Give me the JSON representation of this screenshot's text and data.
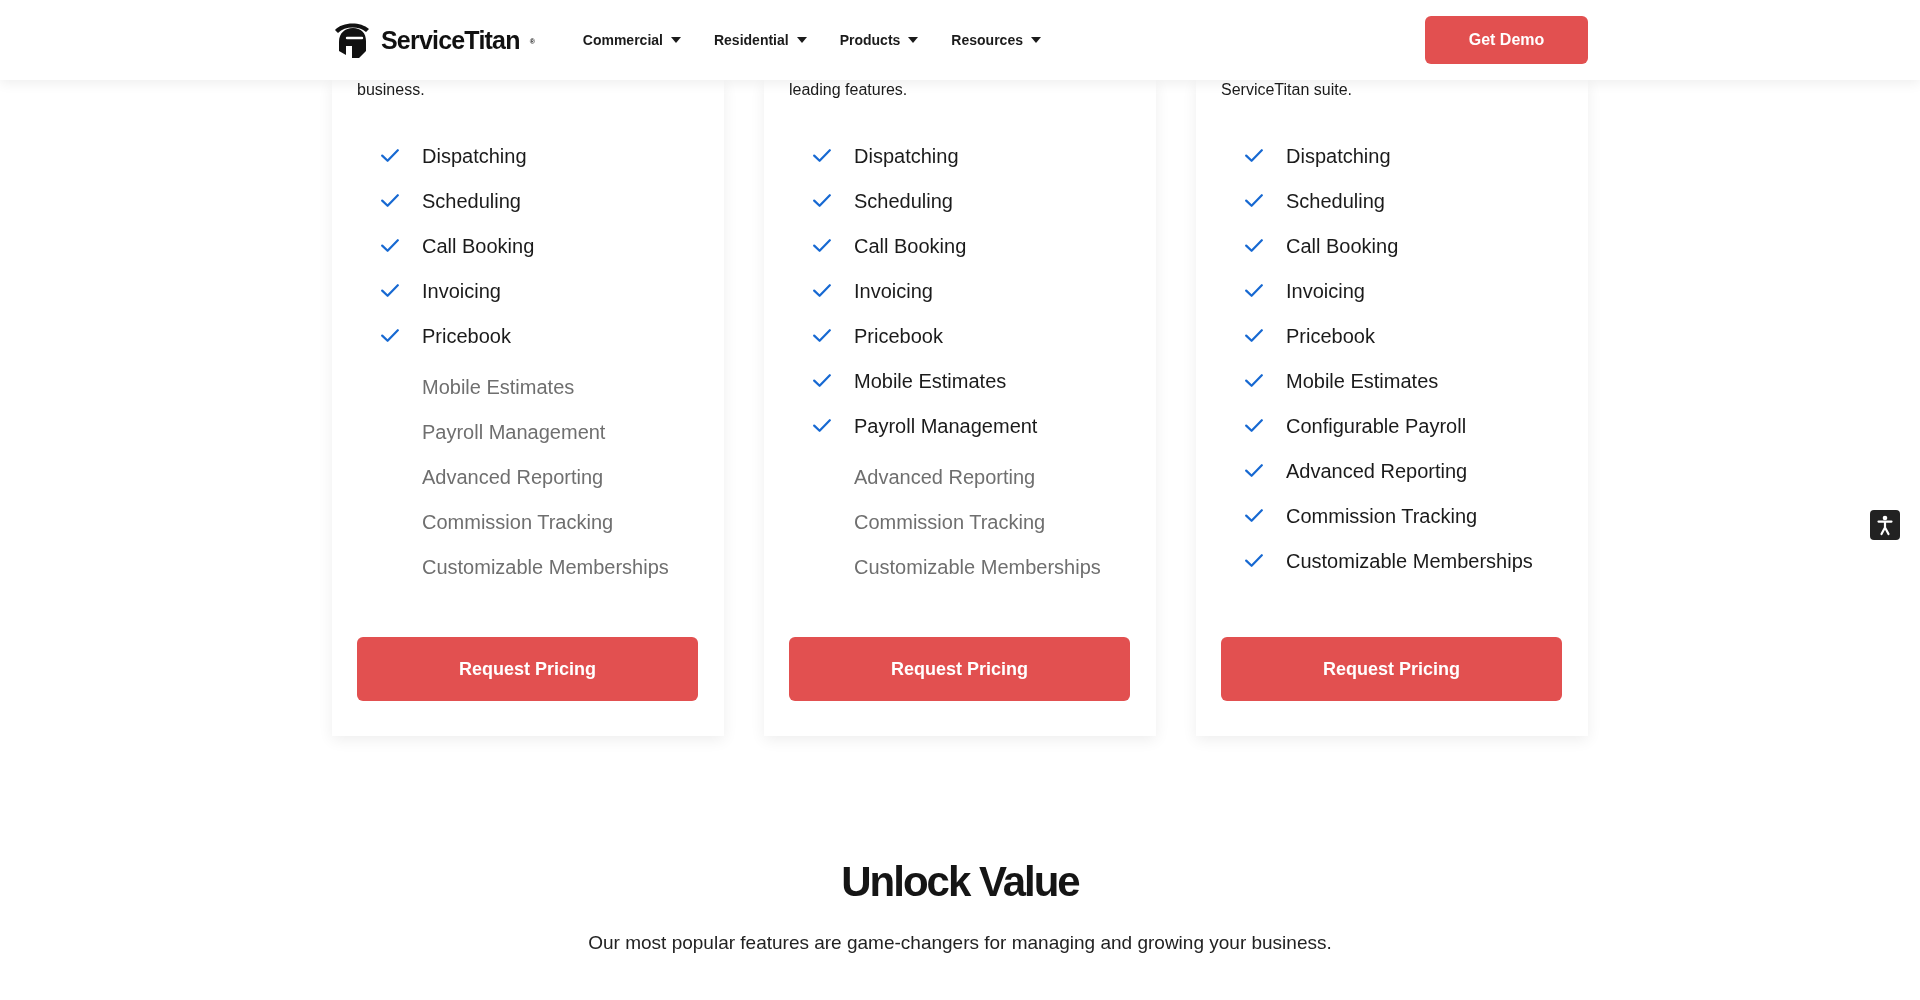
{
  "header": {
    "logo": "ServiceTitan$^{®}$",
    "nav": [
      {
        "label": "Commercial",
        "dropdown": true
      },
      {
        "label": "Residential",
        "dropdown": true
      },
      {
        "label": "Products",
        "dropdown": true
      },
      {
        "label": "Resources",
        "dropdown": true
      }
    ],
    "cta": "Get Demo"
  },
  "plans": [
    {
      "description": "business.",
      "features": [
        {
          "label": "Dispatching",
          "included": true
        },
        {
          "label": "Scheduling",
          "included": true
        },
        {
          "label": "Call Booking",
          "included": true
        },
        {
          "label": "Invoicing",
          "included": true
        },
        {
          "label": "Pricebook",
          "included": true
        },
        {
          "label": "Mobile Estimates",
          "included": false
        },
        {
          "label": "Payroll Management",
          "included": false
        },
        {
          "label": "Advanced Reporting",
          "included": false
        },
        {
          "label": "Commission Tracking",
          "included": false
        },
        {
          "label": "Customizable Memberships",
          "included": false
        }
      ],
      "button": "Request Pricing"
    },
    {
      "description": "leading features.",
      "features": [
        {
          "label": "Dispatching",
          "included": true
        },
        {
          "label": "Scheduling",
          "included": true
        },
        {
          "label": "Call Booking",
          "included": true
        },
        {
          "label": "Invoicing",
          "included": true
        },
        {
          "label": "Pricebook",
          "included": true
        },
        {
          "label": "Mobile Estimates",
          "included": true
        },
        {
          "label": "Payroll Management",
          "included": true
        },
        {
          "label": "Advanced Reporting",
          "included": false
        },
        {
          "label": "Commission Tracking",
          "included": false
        },
        {
          "label": "Customizable Memberships",
          "included": false
        }
      ],
      "button": "Request Pricing"
    },
    {
      "description": "ServiceTitan suite.",
      "features": [
        {
          "label": "Dispatching",
          "included": true
        },
        {
          "label": "Scheduling",
          "included": true
        },
        {
          "label": "Call Booking",
          "included": true
        },
        {
          "label": "Invoicing",
          "included": true
        },
        {
          "label": "Pricebook",
          "included": true
        },
        {
          "label": "Mobile Estimates",
          "included": true
        },
        {
          "label": "Configurable Payroll",
          "included": true
        },
        {
          "label": "Advanced Reporting",
          "included": true
        },
        {
          "label": "Commission Tracking",
          "included": true
        },
        {
          "label": "Customizable Memberships",
          "included": true
        }
      ],
      "button": "Request Pricing"
    }
  ],
  "unlock_value": {
    "title": "Unlock Value",
    "subtitle": "Our most popular features are game-changers for managing and growing your business."
  }
}
